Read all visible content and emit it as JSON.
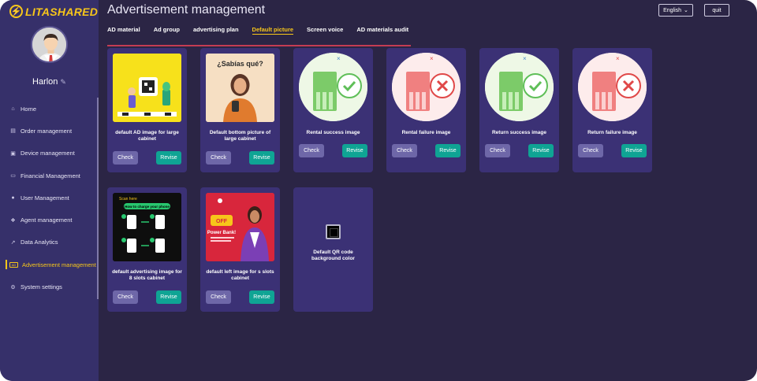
{
  "app": {
    "logo_text": "LITASHARED",
    "page_title": "Advertisement management",
    "language": "English",
    "quit": "quit",
    "accent": "#f7c61a",
    "revise_color": "#0fa494"
  },
  "user": {
    "name": "Harlon"
  },
  "menu": [
    {
      "label": "Home",
      "icon": "home-icon"
    },
    {
      "label": "Order management",
      "icon": "order-icon"
    },
    {
      "label": "Device management",
      "icon": "device-icon"
    },
    {
      "label": "Financial Management",
      "icon": "finance-icon"
    },
    {
      "label": "User Management",
      "icon": "user-icon"
    },
    {
      "label": "Agent management",
      "icon": "agent-icon"
    },
    {
      "label": "Data Analytics",
      "icon": "chart-icon"
    },
    {
      "label": "Advertisement management",
      "icon": "ad-icon",
      "icon_text": "AD"
    },
    {
      "label": "System settings",
      "icon": "gear-icon"
    }
  ],
  "tabs": [
    {
      "label": "AD material"
    },
    {
      "label": "Ad group"
    },
    {
      "label": "advertising plan"
    },
    {
      "label": "Default picture"
    },
    {
      "label": "Screen voice"
    },
    {
      "label": "AD materials audit"
    }
  ],
  "image_texts": {
    "sabias": "¿Sabías qué?",
    "scan_here": "Scan here",
    "how_to_charge": "How to charge your phone",
    "power_bank": "Power Bank!"
  },
  "cards": [
    {
      "label": "default AD image for large cabinet",
      "check": "Check",
      "revise": "Revise"
    },
    {
      "label": "Default bottom picture of large cabinet",
      "check": "Check",
      "revise": "Revise"
    },
    {
      "label": "Rental success image",
      "check": "Check",
      "revise": "Revise"
    },
    {
      "label": "Rental failure image",
      "check": "Check",
      "revise": "Revise"
    },
    {
      "label": "Return success image",
      "check": "Check",
      "revise": "Revise"
    },
    {
      "label": "Return failure image",
      "check": "Check",
      "revise": "Revise"
    },
    {
      "label": "default advertising image for 8 slots cabinet",
      "check": "Check",
      "revise": "Revise"
    },
    {
      "label": "default left image for s slots cabinet",
      "check": "Check",
      "revise": "Revise"
    },
    {
      "label": "Default QR code background color"
    }
  ]
}
